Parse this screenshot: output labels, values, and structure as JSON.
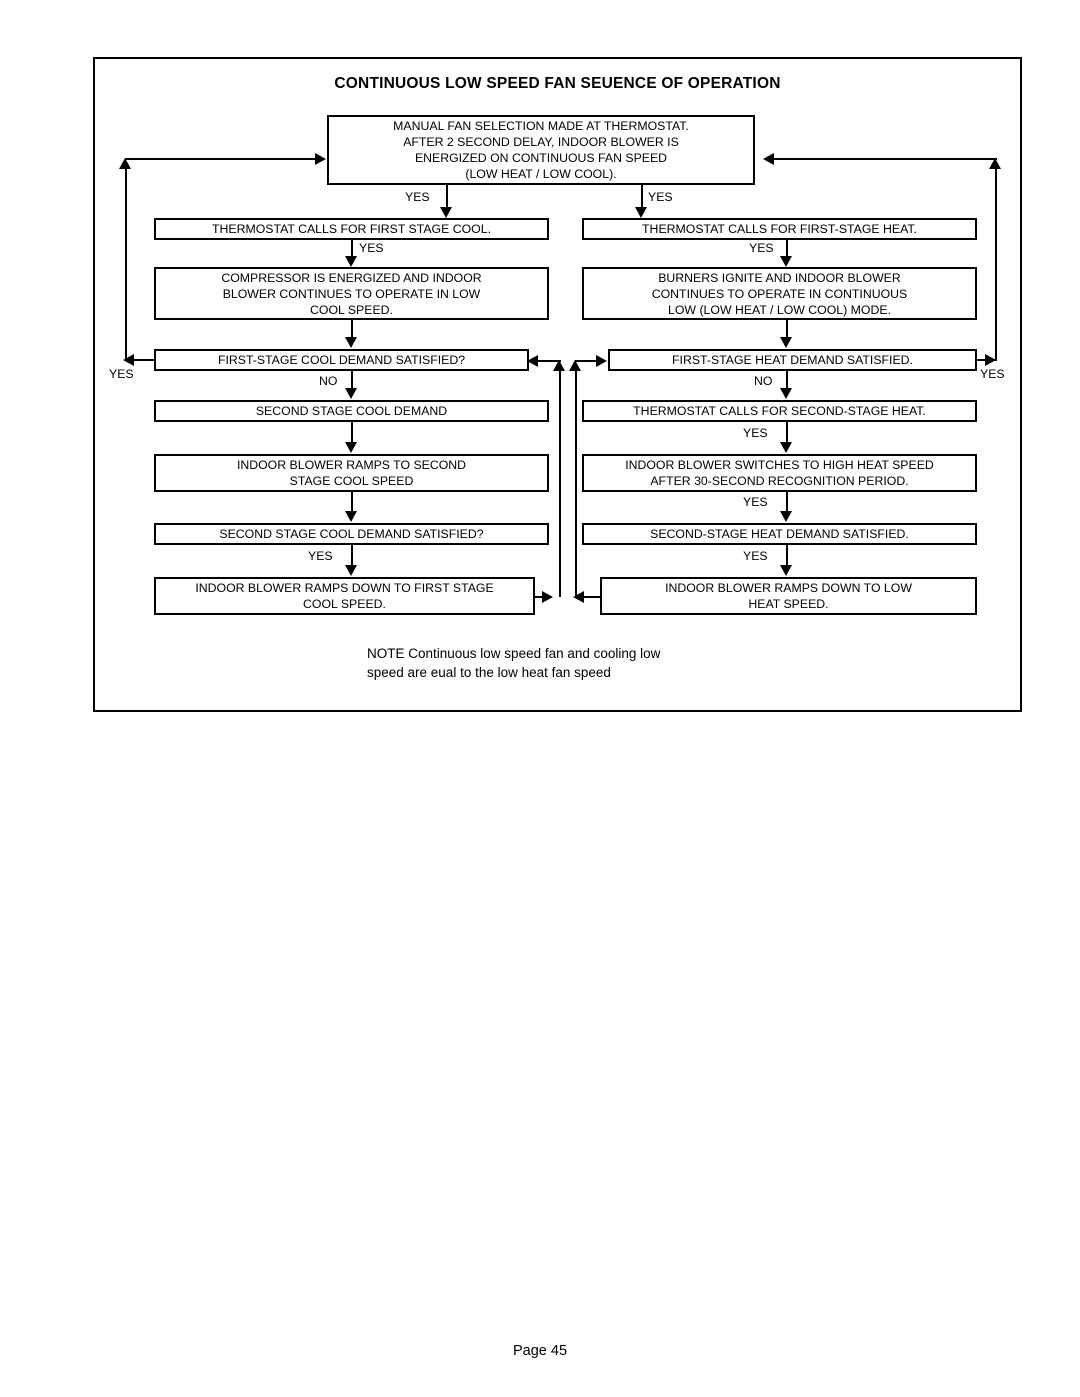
{
  "document": {
    "footer_page_label": "Page 45"
  },
  "diagram": {
    "title": "CONTINUOUS LOW SPEED FAN SEUENCE OF OPERATION",
    "note": "NOTE  Continuous low speed fan and cooling low\nspeed are eual to the low heat fan speed",
    "nodes": {
      "start": "MANUAL FAN SELECTION MADE AT THERMOSTAT.\nAFTER 2 SECOND DELAY, INDOOR BLOWER IS\nENERGIZED ON CONTINUOUS FAN SPEED\n(LOW HEAT / LOW COOL).",
      "cool_1": "THERMOSTAT CALLS FOR FIRST STAGE  COOL.",
      "cool_2": "COMPRESSOR IS ENERGIZED AND INDOOR\nBLOWER CONTINUES TO OPERATE IN LOW\nCOOL SPEED.",
      "cool_3": "FIRST-STAGE COOL DEMAND SATISFIED?",
      "cool_4": "SECOND STAGE COOL DEMAND",
      "cool_5": "INDOOR BLOWER RAMPS TO SECOND\nSTAGE COOL SPEED",
      "cool_6": "SECOND STAGE COOL DEMAND SATISFIED?",
      "cool_7": "INDOOR BLOWER RAMPS DOWN TO FIRST STAGE\nCOOL SPEED.",
      "heat_1": "THERMOSTAT CALLS FOR FIRST-STAGE HEAT.",
      "heat_2": "BURNERS IGNITE AND INDOOR BLOWER\nCONTINUES TO OPERATE IN CONTINUOUS\nLOW (LOW HEAT / LOW COOL) MODE.",
      "heat_3": "FIRST-STAGE HEAT DEMAND SATISFIED.",
      "heat_4": "THERMOSTAT CALLS FOR SECOND-STAGE HEAT.",
      "heat_5": "INDOOR BLOWER SWITCHES TO HIGH HEAT SPEED\nAFTER 30-SECOND RECOGNITION PERIOD.",
      "heat_6": "SECOND-STAGE HEAT DEMAND SATISFIED.",
      "heat_7": "INDOOR BLOWER RAMPS DOWN TO LOW\nHEAT SPEED."
    },
    "edge_labels": {
      "start_to_cool_1": "YES",
      "start_to_heat_1": "YES",
      "cool_1_to_cool_2": "YES",
      "cool_3_loop_yes": "YES",
      "cool_3_to_cool_4": "NO",
      "cool_6_to_cool_7": "YES",
      "heat_1_to_heat_2": "YES",
      "heat_3_loop_yes": "YES",
      "heat_3_to_heat_4": "NO",
      "heat_4_to_heat_5": "YES",
      "heat_5_to_heat_6": "YES",
      "heat_6_to_heat_7": "YES"
    }
  }
}
